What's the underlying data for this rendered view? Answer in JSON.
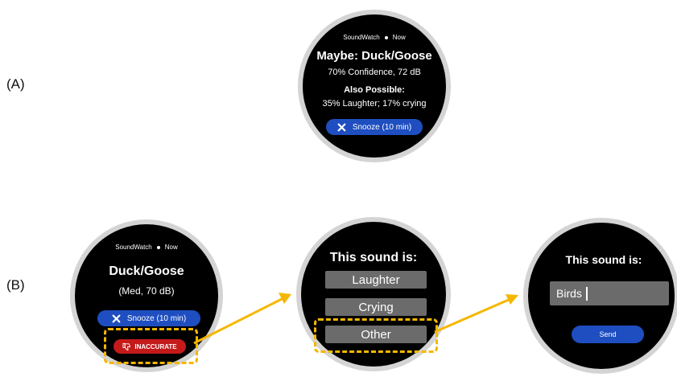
{
  "panel_a": {
    "label": "(A)",
    "header": "SoundWatch",
    "header_time": "Now",
    "title": "Maybe: Duck/Goose",
    "detail": "70% Confidence, 72 dB",
    "also_heading": "Also Possible:",
    "also_detail": "35% Laughter; 17% crying",
    "snooze_label": "Snooze (10 min)"
  },
  "panel_b": {
    "label": "(B)",
    "watch1": {
      "header": "SoundWatch",
      "header_time": "Now",
      "title": "Duck/Goose",
      "detail": "(Med, 70 dB)",
      "snooze_label": "Snooze (10 min)",
      "inaccurate_label": "INACCURATE"
    },
    "watch2": {
      "heading": "This sound is:",
      "options": [
        "Laughter",
        "Crying",
        "Other"
      ]
    },
    "watch3": {
      "heading": "This sound is:",
      "input_value": "Birds",
      "send_label": "Send"
    }
  },
  "colors": {
    "snooze_blue": "#1e4ec0",
    "inaccurate_red": "#c41a1a",
    "highlight_yellow": "#f5b700",
    "option_gray": "#6b6b6b"
  }
}
